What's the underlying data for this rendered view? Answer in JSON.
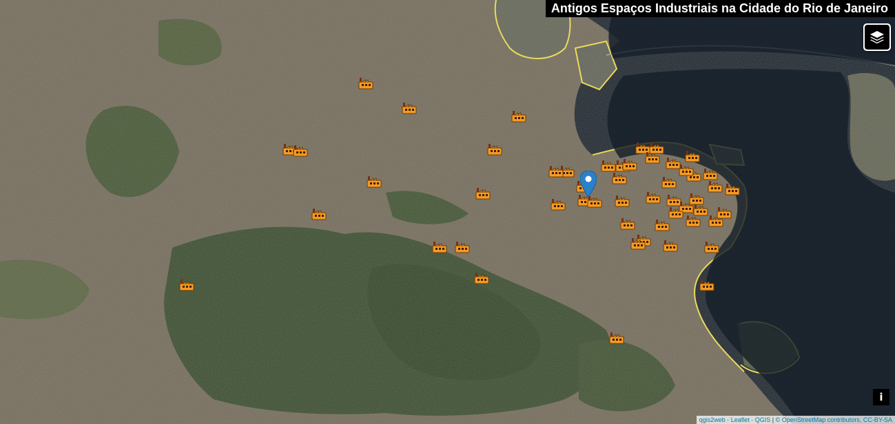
{
  "title": "Antigos Espaços Industriais na Cidade do Rio de Janeiro",
  "controls": {
    "layers_icon": "layers-icon",
    "info_label": "i"
  },
  "attribution": {
    "qgis2web": "qgis2web",
    "leaflet": "Leaflet",
    "qgis": "QGIS",
    "osm": "© OpenStreetMap contributors, CC-BY-SA",
    "sep1": " · ",
    "sep2": " · ",
    "sep3": " | "
  },
  "marker_icon": "factory-icon",
  "selected_marker_icon": "map-pin-icon",
  "colors": {
    "marker_fill": "#f59a23",
    "pin": "#2a81cb",
    "coastline": "#f2e14a",
    "water": "#16202a"
  }
}
